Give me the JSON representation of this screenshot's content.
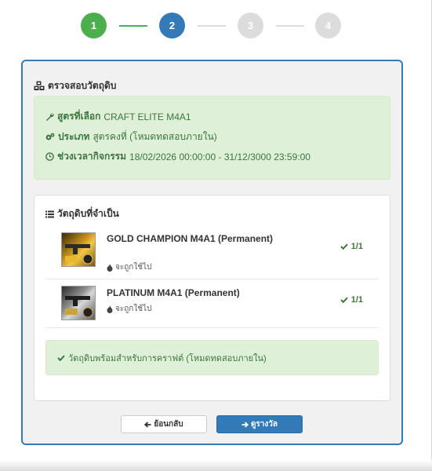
{
  "stepper": {
    "steps": [
      {
        "num": "1",
        "state": "done"
      },
      {
        "num": "2",
        "state": "active"
      },
      {
        "num": "3",
        "state": "todo"
      },
      {
        "num": "4",
        "state": "todo"
      }
    ]
  },
  "panel": {
    "title": "ตรวจสอบวัตถุดิบ",
    "info": {
      "recipe_label": "สูตรที่เลือก",
      "recipe_value": "CRAFT ELITE M4A1",
      "type_label": "ประเภท",
      "type_value": "สูตรคงที่ (โหมดทดสอบภายใน)",
      "period_label": "ช่วงเวลากิจกรรม",
      "period_value": "18/02/2026 00:00:00 - 31/12/3000 23:59:00"
    },
    "requirements": {
      "title": "วัตถุดิบที่จำเป็น",
      "items": [
        {
          "name": "GOLD CHAMPION M4A1 (Permanent)",
          "use": "จะถูกใช้ไป",
          "qty": "1/1"
        },
        {
          "name": "PLATINUM M4A1 (Permanent)",
          "use": "จะถูกใช้ไป",
          "qty": "1/1"
        }
      ],
      "ready": "วัตถุดิบพร้อมสำหรับการคราฟต์ (โหมดทดสอบภายใน)"
    },
    "buttons": {
      "back": "ย้อนกลับ",
      "next": "ดูรางวัล"
    }
  },
  "colors": {
    "primary": "#337ab7",
    "success": "#4cae4c",
    "success_text": "#3c763d",
    "success_bg": "#dff0d8"
  }
}
